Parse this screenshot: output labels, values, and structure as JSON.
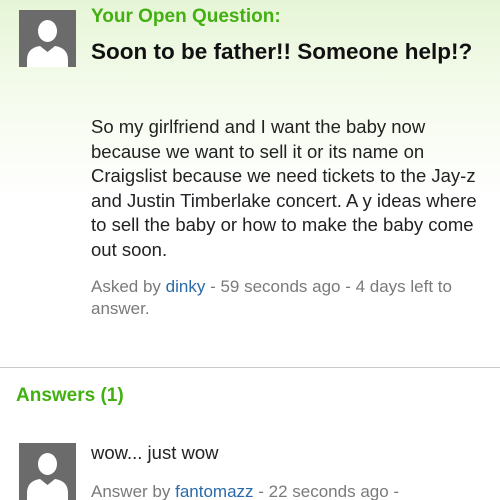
{
  "question": {
    "section_label": "Your Open Question:",
    "title": "Soon to be father!! Someone help!?",
    "body": "So my girlfriend and I want the baby now because we want to sell it or its name on Craigslist because we need tickets to the Jay-z and Justin Timberlake concert. A y ideas where to sell the baby or how to make the baby come out soon.",
    "asked_prefix": "Asked by ",
    "asker": "dinky",
    "asked_suffix": " - 59 seconds ago - 4 days left to answer.",
    "avatar_icon": "default-user-icon"
  },
  "answers": {
    "heading": "Answers (1)",
    "items": [
      {
        "text": "wow... just wow",
        "meta_prefix": "Answer by ",
        "author": "fantomazz",
        "meta_suffix": " - 22 seconds ago -",
        "avatar_icon": "default-user-icon"
      }
    ]
  },
  "colors": {
    "accent_green": "#43b012",
    "link_blue": "#2a6aa8",
    "meta_gray": "#7a7a7a",
    "avatar_bg": "#6b6b6b"
  }
}
